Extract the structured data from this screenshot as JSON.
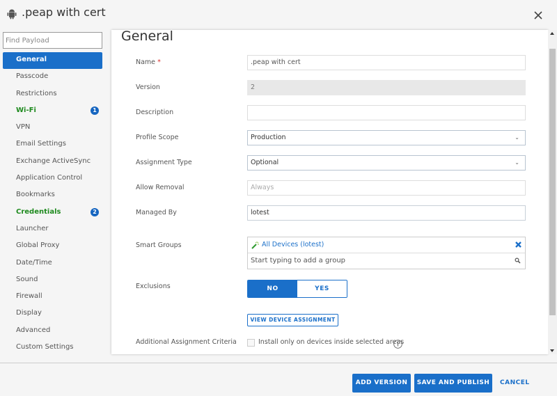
{
  "header": {
    "platform_icon": "android-icon",
    "title": ".peap with cert",
    "close_icon": "close-icon"
  },
  "sidebar": {
    "search_placeholder": "Find Payload",
    "items": [
      {
        "label": "General",
        "state": "active"
      },
      {
        "label": "Passcode"
      },
      {
        "label": "Restrictions"
      },
      {
        "label": "Wi-Fi",
        "state": "configured",
        "badge": "1"
      },
      {
        "label": "VPN"
      },
      {
        "label": "Email Settings"
      },
      {
        "label": "Exchange ActiveSync"
      },
      {
        "label": "Application Control"
      },
      {
        "label": "Bookmarks"
      },
      {
        "label": "Credentials",
        "state": "configured",
        "badge": "2"
      },
      {
        "label": "Launcher"
      },
      {
        "label": "Global Proxy"
      },
      {
        "label": "Date/Time"
      },
      {
        "label": "Sound"
      },
      {
        "label": "Firewall"
      },
      {
        "label": "Display"
      },
      {
        "label": "Advanced"
      },
      {
        "label": "Custom Settings"
      }
    ]
  },
  "main": {
    "section_title": "General",
    "fields": {
      "name": {
        "label": "Name",
        "required_mark": "*",
        "value": ".peap with cert"
      },
      "version": {
        "label": "Version",
        "value": "2"
      },
      "description": {
        "label": "Description",
        "value": ""
      },
      "profile_scope": {
        "label": "Profile Scope",
        "value": "Production"
      },
      "assignment_type": {
        "label": "Assignment Type",
        "value": "Optional"
      },
      "allow_removal": {
        "label": "Allow Removal",
        "value": "Always"
      },
      "managed_by": {
        "label": "Managed By",
        "value": "lotest"
      },
      "smart_groups": {
        "label": "Smart Groups",
        "selected": "All Devices (lotest)",
        "placeholder": "Start typing to add a group"
      },
      "exclusions": {
        "label": "Exclusions",
        "options": [
          "NO",
          "YES"
        ],
        "selected": "NO"
      },
      "view_device_assignment": "VIEW DEVICE ASSIGNMENT",
      "additional_criteria": {
        "label": "Additional Assignment Criteria",
        "checkbox_label": "Install only on devices inside selected areas",
        "checked": false
      }
    }
  },
  "footer": {
    "add_version": "ADD VERSION",
    "save_and_publish": "SAVE AND PUBLISH",
    "cancel": "CANCEL"
  },
  "colors": {
    "accent": "#1a6fc9",
    "configured": "#1e8a1e",
    "required": "#d9302c"
  }
}
